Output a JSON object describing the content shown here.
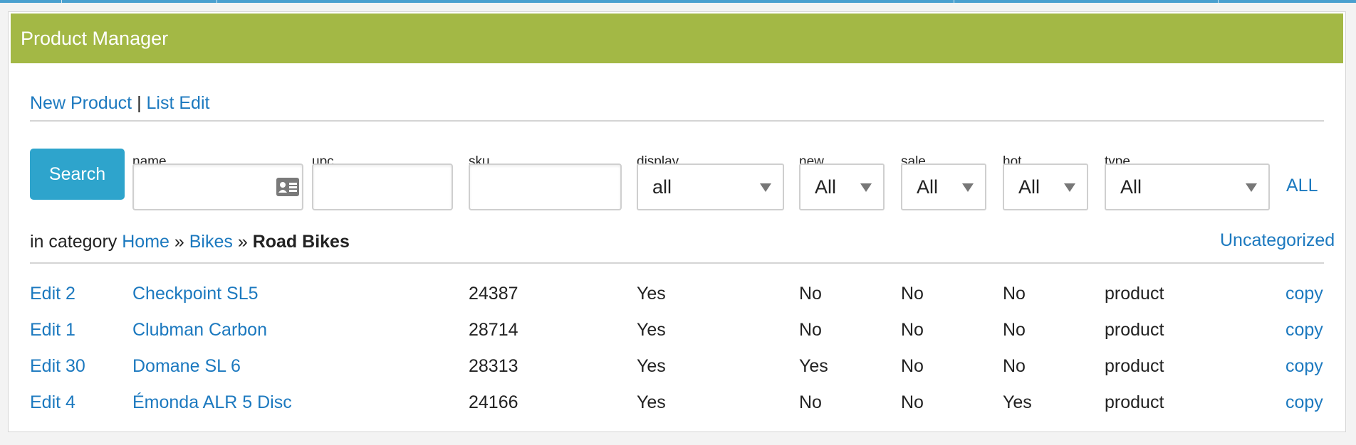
{
  "colors": {
    "header_bg": "#a3b845",
    "link": "#1c79bf",
    "search_button": "#2ea4cc",
    "top_strip": "#4aa0cf"
  },
  "panel": {
    "title": "Product Manager"
  },
  "actions": {
    "new_product": "New Product",
    "separator": "|",
    "list_edit": "List Edit"
  },
  "search": {
    "button_label": "Search",
    "fields": {
      "name": {
        "label": "name",
        "value": "",
        "icon": "contact-card-icon"
      },
      "upc": {
        "label": "upc",
        "value": ""
      },
      "sku": {
        "label": "sku",
        "value": ""
      }
    },
    "selects": {
      "display": {
        "label": "display",
        "selected": "all"
      },
      "new": {
        "label": "new",
        "selected": "All"
      },
      "sale": {
        "label": "sale",
        "selected": "All"
      },
      "hot": {
        "label": "hot",
        "selected": "All"
      },
      "type": {
        "label": "type",
        "selected": "All"
      }
    },
    "all_link": "ALL"
  },
  "category": {
    "prefix": "in category",
    "crumbs": [
      "Home",
      "Bikes"
    ],
    "separator": "»",
    "current": "Road Bikes",
    "uncategorized_link": "Uncategorized"
  },
  "products": [
    {
      "edit": "Edit 2",
      "name": "Checkpoint SL5",
      "sku": "24387",
      "display": "Yes",
      "new": "No",
      "sale": "No",
      "hot": "No",
      "type": "product",
      "copy": "copy"
    },
    {
      "edit": "Edit 1",
      "name": "Clubman Carbon",
      "sku": "28714",
      "display": "Yes",
      "new": "No",
      "sale": "No",
      "hot": "No",
      "type": "product",
      "copy": "copy"
    },
    {
      "edit": "Edit 30",
      "name": "Domane SL 6",
      "sku": "28313",
      "display": "Yes",
      "new": "Yes",
      "sale": "No",
      "hot": "No",
      "type": "product",
      "copy": "copy"
    },
    {
      "edit": "Edit 4",
      "name": "Émonda ALR 5 Disc",
      "sku": "24166",
      "display": "Yes",
      "new": "No",
      "sale": "No",
      "hot": "Yes",
      "type": "product",
      "copy": "copy"
    }
  ]
}
